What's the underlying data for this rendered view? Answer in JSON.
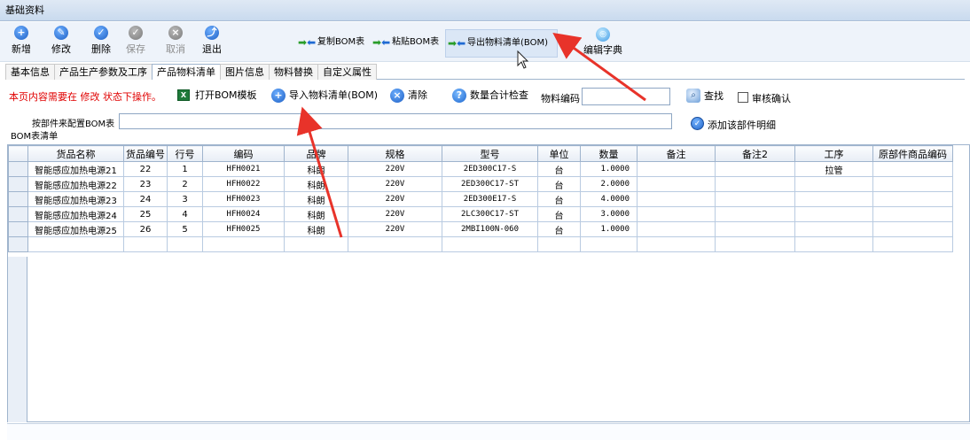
{
  "window": {
    "title": "基础资料"
  },
  "toolbar": {
    "new": "新增",
    "edit": "修改",
    "delete": "删除",
    "save": "保存",
    "cancel": "取消",
    "exit": "退出",
    "copy_bom": "复制BOM表",
    "paste_bom": "粘贴BOM表",
    "export_bom": "导出物料清单(BOM)",
    "edit_dict": "编辑字典"
  },
  "tabs": [
    "基本信息",
    "产品生产参数及工序",
    "产品物料清单",
    "图片信息",
    "物料替换",
    "自定义属性"
  ],
  "actions": {
    "warning": "本页内容需要在 修改 状态下操作。",
    "open_template": "打开BOM模板",
    "import_bom": "导入物料清单(BOM)",
    "clear": "清除",
    "qty_check": "数量合计检查",
    "material_code_label": "物料编码",
    "material_code_value": "",
    "search": "查找",
    "audit_confirm": "审核确认",
    "config_by_part_label": "按部件来配置BOM表",
    "config_by_part_value": "",
    "add_part_detail": "添加该部件明细"
  },
  "grid": {
    "caption": "BOM表清单",
    "columns": [
      "货品名称",
      "货品编号",
      "行号",
      "编码",
      "品牌",
      "规格",
      "型号",
      "单位",
      "数量",
      "备注",
      "备注2",
      "工序",
      "原部件商品编码"
    ],
    "rows": [
      [
        "智能感应加热电源21",
        "22",
        "1",
        "HFH0021",
        "科朗",
        "220V",
        "2ED300C17-S",
        "台",
        "1.0000",
        "",
        "",
        "拉管",
        ""
      ],
      [
        "智能感应加热电源22",
        "23",
        "2",
        "HFH0022",
        "科朗",
        "220V",
        "2ED300C17-ST",
        "台",
        "2.0000",
        "",
        "",
        "",
        ""
      ],
      [
        "智能感应加热电源23",
        "24",
        "3",
        "HFH0023",
        "科朗",
        "220V",
        "2ED300E17-S",
        "台",
        "4.0000",
        "",
        "",
        "",
        ""
      ],
      [
        "智能感应加热电源24",
        "25",
        "4",
        "HFH0024",
        "科朗",
        "220V",
        "2LC300C17-ST",
        "台",
        "3.0000",
        "",
        "",
        "",
        ""
      ],
      [
        "智能感应加热电源25",
        "26",
        "5",
        "HFH0025",
        "科朗",
        "220V",
        "2MBI100N-060",
        "台",
        "1.0000",
        "",
        "",
        "",
        ""
      ],
      [
        "",
        "",
        "",
        "",
        "",
        "",
        "",
        "",
        "",
        "",
        "",
        "",
        ""
      ]
    ]
  },
  "colors": {
    "annotation_arrow": "#e8332a",
    "warning_text": "#e00000"
  }
}
